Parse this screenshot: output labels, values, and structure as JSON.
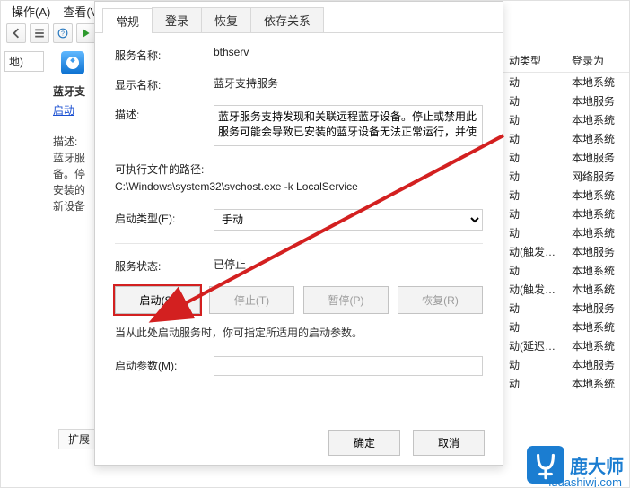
{
  "menu": {
    "item1": "操作(A)",
    "item2": "查看(V)"
  },
  "left_panel": {
    "addr_suffix": "地)"
  },
  "center_panel": {
    "title": "蓝牙支",
    "start_link": "启动",
    "desc_lbl": "描述:",
    "desc": "蓝牙服\n备。停\n安装的\n新设备"
  },
  "dialog": {
    "tabs": {
      "general": "常规",
      "logon": "登录",
      "recovery": "恢复",
      "deps": "依存关系"
    },
    "service_name_lbl": "服务名称:",
    "service_name": "bthserv",
    "display_name_lbl": "显示名称:",
    "display_name": "蓝牙支持服务",
    "desc_lbl": "描述:",
    "desc": "蓝牙服务支持发现和关联远程蓝牙设备。停止或禁用此服务可能会导致已安装的蓝牙设备无法正常运行，并使",
    "exe_path_lbl": "可执行文件的路径:",
    "exe_path": "C:\\Windows\\system32\\svchost.exe -k LocalService",
    "startup_type_lbl": "启动类型(E):",
    "startup_type": "手动",
    "status_lbl": "服务状态:",
    "status": "已停止",
    "btn_start": "启动(S)",
    "btn_stop": "停止(T)",
    "btn_pause": "暂停(P)",
    "btn_resume": "恢复(R)",
    "note": "当从此处启动服务时，你可指定所适用的启动参数。",
    "start_params_lbl": "启动参数(M):",
    "start_params": "",
    "ok": "确定",
    "cancel": "取消"
  },
  "list": {
    "col1": "动类型",
    "col2": "登录为",
    "rows": [
      {
        "a": "动",
        "b": "本地系统"
      },
      {
        "a": "动",
        "b": "本地服务"
      },
      {
        "a": "动",
        "b": "本地系统"
      },
      {
        "a": "动",
        "b": "本地系统"
      },
      {
        "a": "动",
        "b": "本地服务"
      },
      {
        "a": "动",
        "b": "网络服务"
      },
      {
        "a": "动",
        "b": "本地系统"
      },
      {
        "a": "动",
        "b": "本地系统"
      },
      {
        "a": "动",
        "b": "本地系统"
      },
      {
        "a": "动(触发…",
        "b": "本地服务"
      },
      {
        "a": "动",
        "b": "本地系统"
      },
      {
        "a": "动(触发…",
        "b": "本地系统"
      },
      {
        "a": "动",
        "b": "本地服务"
      },
      {
        "a": "动",
        "b": "本地系统"
      },
      {
        "a": "动(延迟…",
        "b": "本地系统"
      },
      {
        "a": "动",
        "b": "本地服务"
      },
      {
        "a": "动",
        "b": "本地系统"
      }
    ]
  },
  "extend_tab": "扩展",
  "watermark": {
    "brand": "鹿大师",
    "url": "ludashiwj.com"
  }
}
